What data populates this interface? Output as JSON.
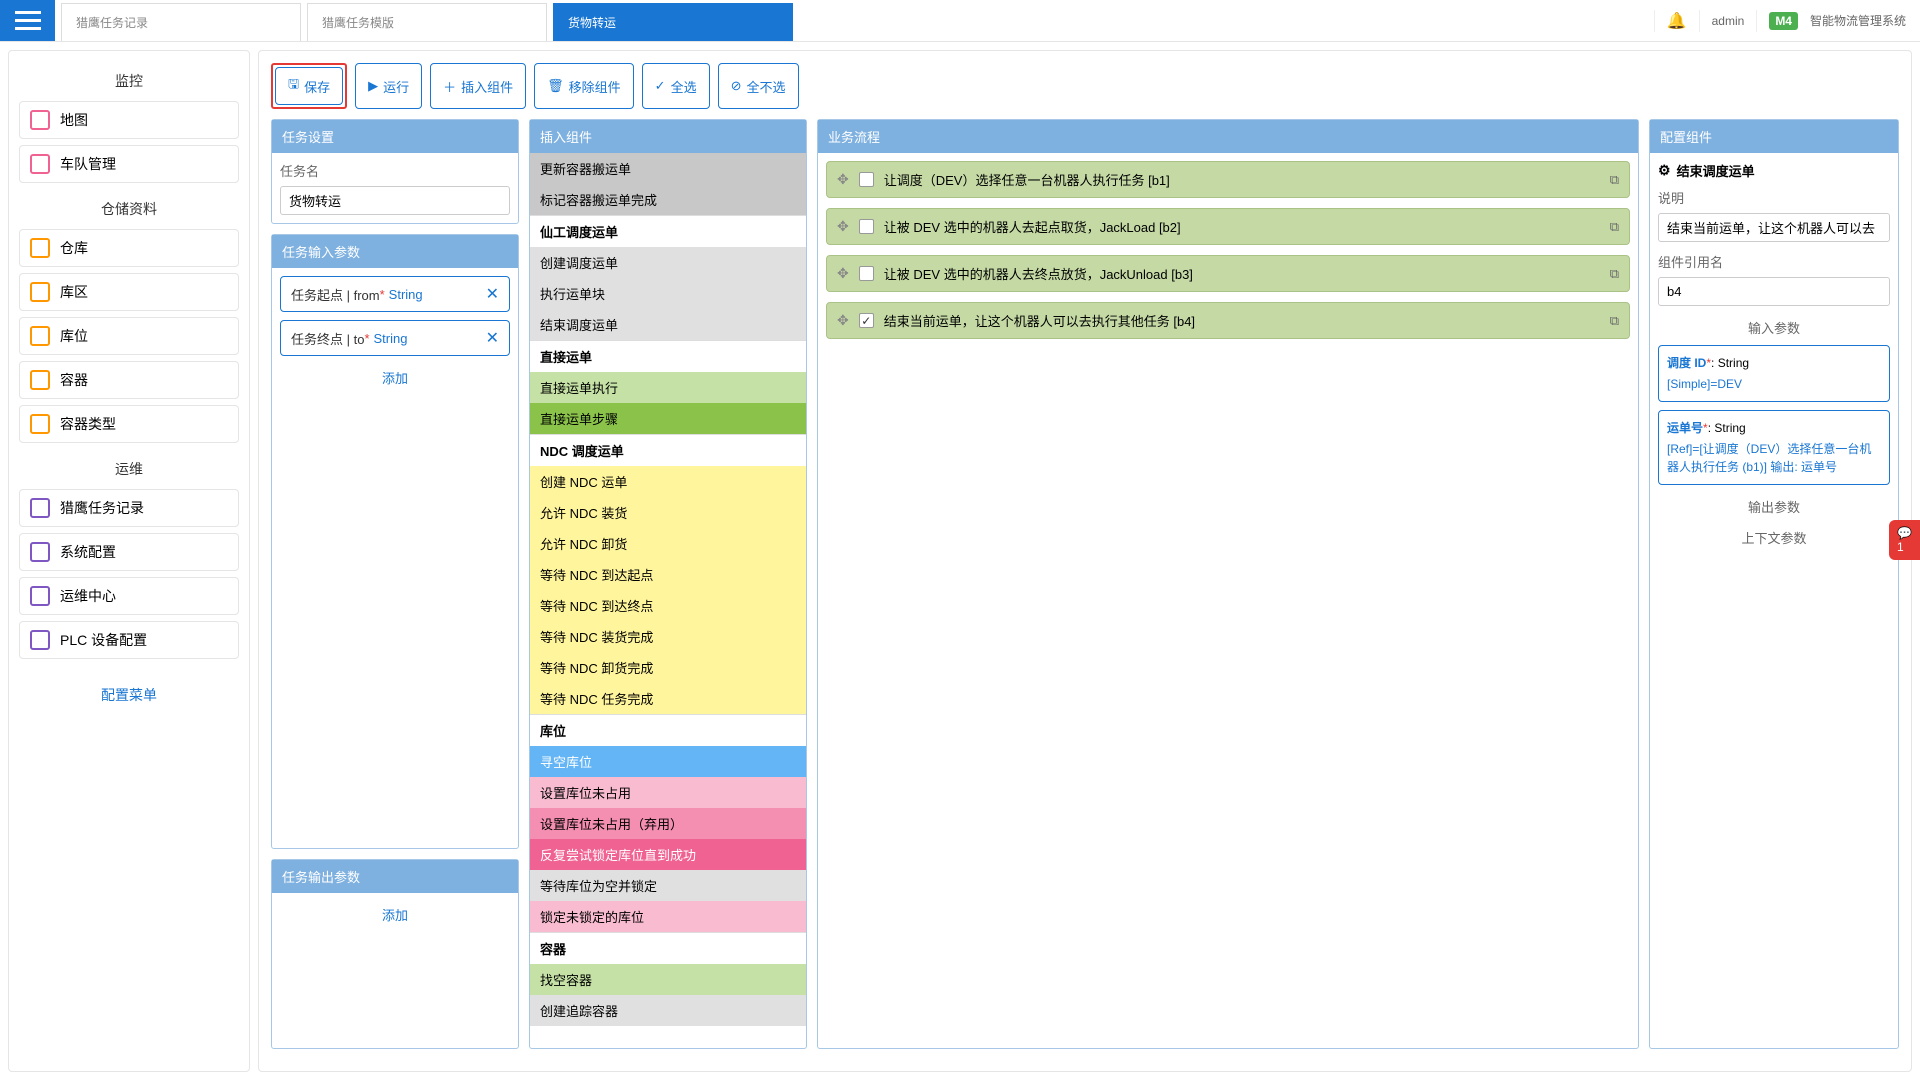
{
  "app_name": "智能物流管理系统",
  "badge": "M4",
  "user": "admin",
  "tabs": [
    {
      "label": "猎鹰任务记录",
      "active": false
    },
    {
      "label": "猎鹰任务模版",
      "active": false
    },
    {
      "label": "货物转运",
      "active": true
    }
  ],
  "sidebar": {
    "groups": [
      {
        "title": "监控",
        "icon": "pink",
        "items": [
          "地图",
          "车队管理"
        ]
      },
      {
        "title": "仓储资料",
        "icon": "orange",
        "items": [
          "仓库",
          "库区",
          "库位",
          "容器",
          "容器类型"
        ]
      },
      {
        "title": "运维",
        "icon": "purple",
        "items": [
          "猎鹰任务记录",
          "系统配置",
          "运维中心",
          "PLC 设备配置"
        ]
      }
    ],
    "config_menu": "配置菜单"
  },
  "toolbar": {
    "save": "保存",
    "run": "运行",
    "insert": "插入组件",
    "remove": "移除组件",
    "select_all": "全选",
    "select_none": "全不选"
  },
  "task_settings": {
    "title": "任务设置",
    "name_label": "任务名",
    "name_value": "货物转运"
  },
  "task_input_params": {
    "title": "任务输入参数",
    "params": [
      {
        "name": "任务起点 | from",
        "required": true,
        "type": "String"
      },
      {
        "name": "任务终点 | to",
        "required": true,
        "type": "String"
      }
    ],
    "add": "添加"
  },
  "task_output_params": {
    "title": "任务输出参数",
    "add": "添加"
  },
  "insert_components": {
    "title": "插入组件",
    "groups": [
      {
        "header": null,
        "items": [
          {
            "label": "更新容器搬运单",
            "cls": "c-grey"
          },
          {
            "label": "标记容器搬运单完成",
            "cls": "c-grey"
          }
        ]
      },
      {
        "header": "仙工调度运单",
        "items": [
          {
            "label": "创建调度运单",
            "cls": "c-lgrey"
          },
          {
            "label": "执行运单块",
            "cls": "c-lgrey"
          },
          {
            "label": "结束调度运单",
            "cls": "c-lgrey"
          }
        ]
      },
      {
        "header": "直接运单",
        "items": [
          {
            "label": "直接运单执行",
            "cls": "c-lgreen"
          },
          {
            "label": "直接运单步骤",
            "cls": "c-green"
          }
        ]
      },
      {
        "header": "NDC 调度运单",
        "items": [
          {
            "label": "创建 NDC 运单",
            "cls": "c-yellow"
          },
          {
            "label": "允许 NDC 装货",
            "cls": "c-yellow"
          },
          {
            "label": "允许 NDC 卸货",
            "cls": "c-yellow"
          },
          {
            "label": "等待 NDC 到达起点",
            "cls": "c-yellow"
          },
          {
            "label": "等待 NDC 到达终点",
            "cls": "c-yellow"
          },
          {
            "label": "等待 NDC 装货完成",
            "cls": "c-yellow"
          },
          {
            "label": "等待 NDC 卸货完成",
            "cls": "c-yellow"
          },
          {
            "label": "等待 NDC 任务完成",
            "cls": "c-yellow"
          }
        ]
      },
      {
        "header": "库位",
        "items": [
          {
            "label": "寻空库位",
            "cls": "c-blue"
          },
          {
            "label": "设置库位未占用",
            "cls": "c-pink1"
          },
          {
            "label": "设置库位未占用（弃用）",
            "cls": "c-pink2"
          },
          {
            "label": "反复尝试锁定库位直到成功",
            "cls": "c-magenta"
          },
          {
            "label": "等待库位为空并锁定",
            "cls": "c-lgrey"
          },
          {
            "label": "锁定未锁定的库位",
            "cls": "c-pink1"
          }
        ]
      },
      {
        "header": "容器",
        "items": [
          {
            "label": "找空容器",
            "cls": "c-lgreen"
          },
          {
            "label": "创建追踪容器",
            "cls": "c-lgrey"
          }
        ]
      }
    ]
  },
  "flow": {
    "title": "业务流程",
    "steps": [
      {
        "label": "让调度（DEV）选择任意一台机器人执行任务 [b1]",
        "checked": false
      },
      {
        "label": "让被 DEV 选中的机器人去起点取货，JackLoad [b2]",
        "checked": false
      },
      {
        "label": "让被 DEV 选中的机器人去终点放货，JackUnload [b3]",
        "checked": false
      },
      {
        "label": "结束当前运单，让这个机器人可以去执行其他任务 [b4]",
        "checked": true
      }
    ]
  },
  "config": {
    "title": "配置组件",
    "component_name": "结束调度运单",
    "desc_label": "说明",
    "desc_value": "结束当前运单，让这个机器人可以去",
    "ref_label": "组件引用名",
    "ref_value": "b4",
    "input_title": "输入参数",
    "params": [
      {
        "name": "调度 ID",
        "required": true,
        "type": "String",
        "value": "[Simple]=DEV"
      },
      {
        "name": "运单号",
        "required": true,
        "type": "String",
        "value": "[Ref]=[让调度（DEV）选择任意一台机器人执行任务 (b1)] 输出: 运单号"
      }
    ],
    "output_title": "输出参数",
    "context_title": "上下文参数"
  },
  "notification": {
    "count": "1"
  }
}
